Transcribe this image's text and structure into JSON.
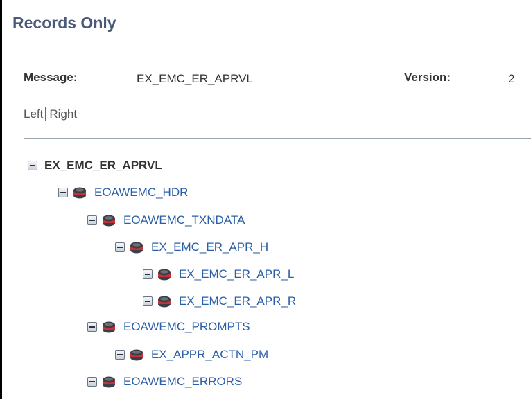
{
  "page": {
    "title": "Records Only"
  },
  "message": {
    "label": "Message:",
    "value": "EX_EMC_ER_APRVL"
  },
  "version": {
    "label": "Version:",
    "value": "2"
  },
  "nav": {
    "left": "Left",
    "right": "Right"
  },
  "tree": {
    "root": "EX_EMC_ER_APRVL",
    "records": [
      "EOAWEMC_HDR",
      "EOAWEMC_TXNDATA",
      "EX_EMC_ER_APR_H",
      "EX_EMC_ER_APR_L",
      "EX_EMC_ER_APR_R",
      "EOAWEMC_PROMPTS",
      "EX_APPR_ACTN_PM",
      "EOAWEMC_ERRORS"
    ]
  },
  "colors": {
    "link": "#2a5ea8",
    "title": "#4a5a7a",
    "db_icon": "#c8313a"
  },
  "icons": {
    "collapse": "collapse-icon",
    "record": "database-icon"
  }
}
